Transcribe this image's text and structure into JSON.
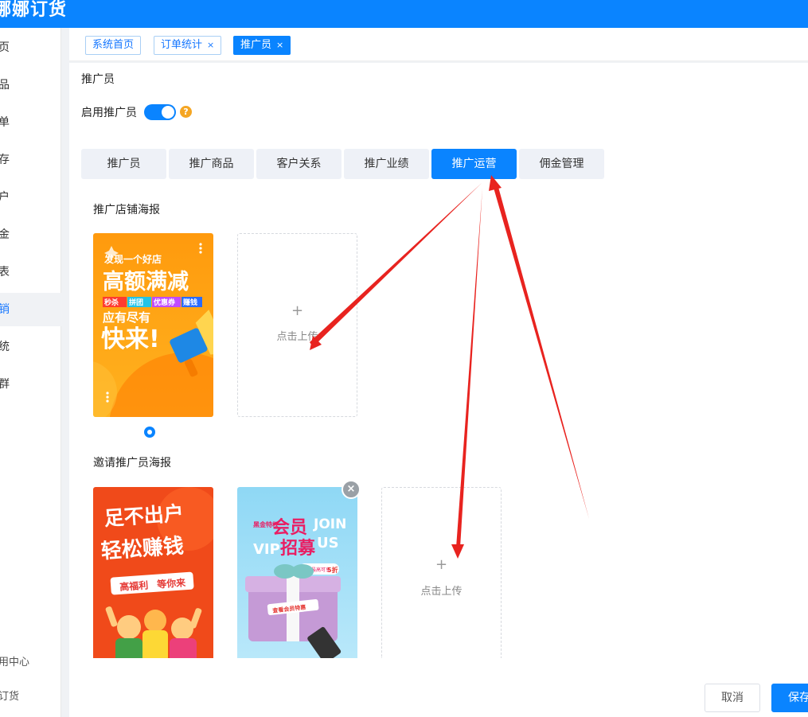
{
  "app": {
    "title": "娜娜订货"
  },
  "sidebar": {
    "items": [
      {
        "label": "页",
        "icon": "home-icon"
      },
      {
        "label": "品",
        "icon": "goods-icon"
      },
      {
        "label": "单",
        "icon": "order-icon"
      },
      {
        "label": "存",
        "icon": "stock-icon"
      },
      {
        "label": "户",
        "icon": "customer-icon"
      },
      {
        "label": "金",
        "icon": "money-icon"
      },
      {
        "label": "表",
        "icon": "report-icon"
      },
      {
        "label": "销",
        "icon": "marketing-icon"
      },
      {
        "label": "统",
        "icon": "system-icon"
      },
      {
        "label": "群",
        "icon": "group-icon"
      }
    ],
    "footer": [
      {
        "label": "用中心"
      },
      {
        "label": "订货"
      }
    ]
  },
  "tags": [
    {
      "label": "系统首页",
      "closable": false
    },
    {
      "label": "订单统计",
      "closable": true
    },
    {
      "label": "推广员",
      "closable": true
    }
  ],
  "close_glyph": "×",
  "page": {
    "title": "推广员",
    "enable_label": "启用推广员",
    "enabled": true,
    "help_glyph": "?"
  },
  "tabs": [
    "推广员",
    "推广商品",
    "客户关系",
    "推广业绩",
    "推广运营",
    "佣金管理"
  ],
  "active_tab": "推广运营",
  "sections": {
    "shop": {
      "title": "推广店铺海报",
      "poster1": {
        "line1": "发现一个好店",
        "line2": "高额满减",
        "chips": [
          "秒杀",
          "拼团",
          "优惠券",
          "赚钱"
        ],
        "line3": "应有尽有",
        "line4": "快来!"
      }
    },
    "invite": {
      "title": "邀请推广员海报",
      "poster1": {
        "line1": "足不出户",
        "line2": "轻松赚钱",
        "banner_a": "高福利",
        "banner_b": "等你来"
      },
      "poster2": {
        "tag_small": "黑金特权",
        "big_a": "会员",
        "big_b": "招募",
        "join": "JOIN",
        "vip": "VIP",
        "us": "US",
        "note_a": "入会最高可享",
        "note_b": "5折",
        "ribbon": "查看会员特惠"
      }
    }
  },
  "upload": {
    "plus": "+",
    "label": "点击上传"
  },
  "actions": {
    "cancel": "取消",
    "save": "保存"
  },
  "colors": {
    "accent": "#0a84ff",
    "arrow": "#e8231f",
    "help": "#f5a623"
  }
}
